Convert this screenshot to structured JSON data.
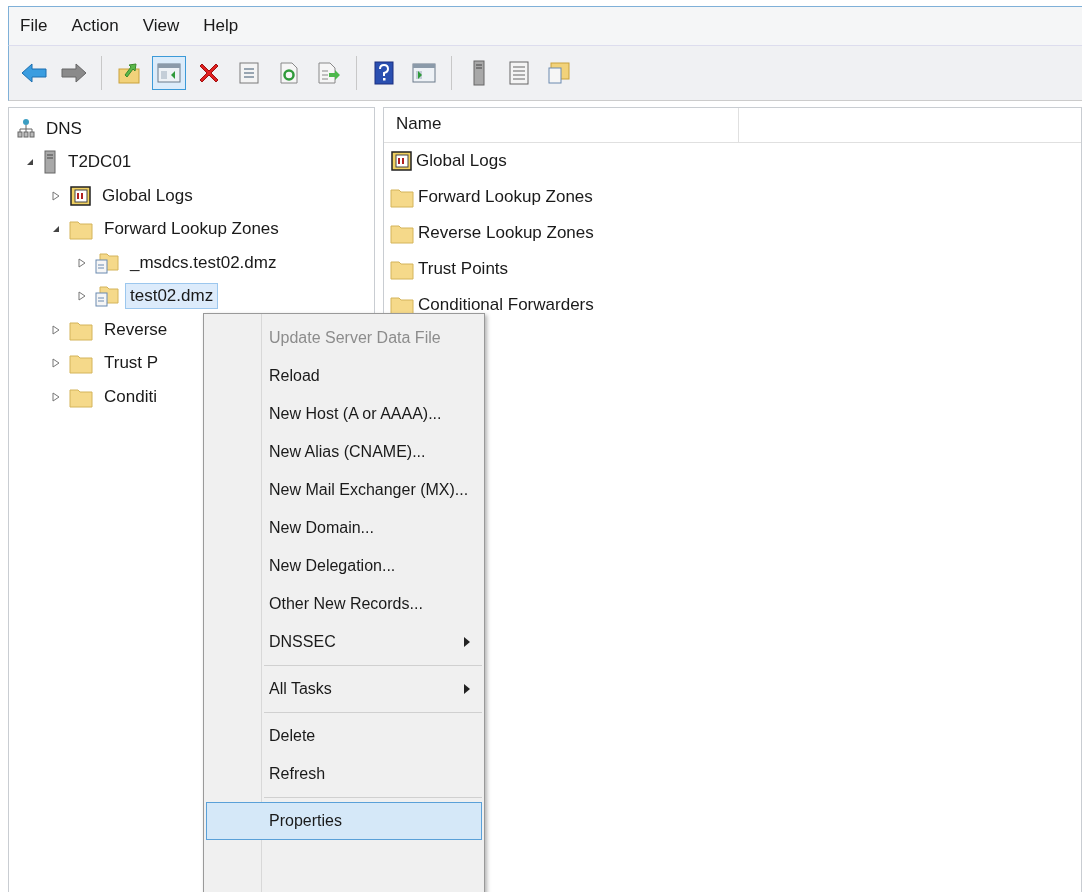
{
  "menu_bar": [
    {
      "label": "File"
    },
    {
      "label": "Action"
    },
    {
      "label": "View"
    },
    {
      "label": "Help"
    }
  ],
  "toolbar": [
    [
      {
        "kind": "back",
        "pressed": false
      },
      {
        "kind": "forward",
        "pressed": false
      }
    ],
    [
      {
        "kind": "up",
        "pressed": false
      },
      {
        "kind": "tree",
        "pressed": true
      },
      {
        "kind": "delete",
        "pressed": false
      },
      {
        "kind": "properties",
        "pressed": false
      },
      {
        "kind": "refresh",
        "pressed": false
      },
      {
        "kind": "export",
        "pressed": false
      }
    ],
    [
      {
        "kind": "help",
        "pressed": false
      },
      {
        "kind": "pane",
        "pressed": false
      }
    ],
    [
      {
        "kind": "server",
        "pressed": false
      },
      {
        "kind": "list",
        "pressed": false
      },
      {
        "kind": "zone",
        "pressed": false
      }
    ]
  ],
  "tree": [
    {
      "label": "DNS",
      "kind": "dns",
      "selected": false,
      "children": [
        {
          "label": "T2DC01",
          "kind": "server",
          "expanded": true,
          "selected": false,
          "children": [
            {
              "label": "Global Logs",
              "kind": "logs",
              "expanded": false,
              "selected": false
            },
            {
              "label": "Forward Lookup Zones",
              "kind": "folder",
              "expanded": true,
              "selected": false,
              "children": [
                {
                  "label": "_msdcs.test02.dmz",
                  "kind": "zone",
                  "expanded": false,
                  "selected": false
                },
                {
                  "label": "test02.dmz",
                  "kind": "zone",
                  "expanded": false,
                  "selected": true
                }
              ]
            },
            {
              "label": "Reverse",
              "kind": "folder",
              "expanded": false,
              "selected": false
            },
            {
              "label": "Trust P",
              "kind": "folder",
              "expanded": false,
              "selected": false
            },
            {
              "label": "Conditi",
              "kind": "folder",
              "expanded": false,
              "selected": false
            }
          ]
        }
      ]
    }
  ],
  "list": {
    "columns": [
      "Name"
    ],
    "rows": [
      {
        "name": "Global Logs",
        "kind": "logs"
      },
      {
        "name": "Forward Lookup Zones",
        "kind": "folder"
      },
      {
        "name": "Reverse Lookup Zones",
        "kind": "folder"
      },
      {
        "name": "Trust Points",
        "kind": "folder"
      },
      {
        "name": "Conditional Forwarders",
        "kind": "folder"
      }
    ]
  },
  "context_menu": [
    {
      "kind": "item",
      "label": "Update Server Data File",
      "disabled": true,
      "submenu": false,
      "selected": false
    },
    {
      "kind": "item",
      "label": "Reload",
      "disabled": false,
      "submenu": false,
      "selected": false
    },
    {
      "kind": "item",
      "label": "New Host (A or AAAA)...",
      "disabled": false,
      "submenu": false,
      "selected": false
    },
    {
      "kind": "item",
      "label": "New Alias (CNAME)...",
      "disabled": false,
      "submenu": false,
      "selected": false
    },
    {
      "kind": "item",
      "label": "New Mail Exchanger (MX)...",
      "disabled": false,
      "submenu": false,
      "selected": false
    },
    {
      "kind": "item",
      "label": "New Domain...",
      "disabled": false,
      "submenu": false,
      "selected": false
    },
    {
      "kind": "item",
      "label": "New Delegation...",
      "disabled": false,
      "submenu": false,
      "selected": false
    },
    {
      "kind": "item",
      "label": "Other New Records...",
      "disabled": false,
      "submenu": false,
      "selected": false
    },
    {
      "kind": "item",
      "label": "DNSSEC",
      "disabled": false,
      "submenu": true,
      "selected": false
    },
    {
      "kind": "separator"
    },
    {
      "kind": "item",
      "label": "All Tasks",
      "disabled": false,
      "submenu": true,
      "selected": false
    },
    {
      "kind": "separator"
    },
    {
      "kind": "item",
      "label": "Delete",
      "disabled": false,
      "submenu": false,
      "selected": false
    },
    {
      "kind": "item",
      "label": "Refresh",
      "disabled": false,
      "submenu": false,
      "selected": false
    },
    {
      "kind": "separator"
    },
    {
      "kind": "item",
      "label": "Properties",
      "disabled": false,
      "submenu": false,
      "selected": true
    }
  ]
}
